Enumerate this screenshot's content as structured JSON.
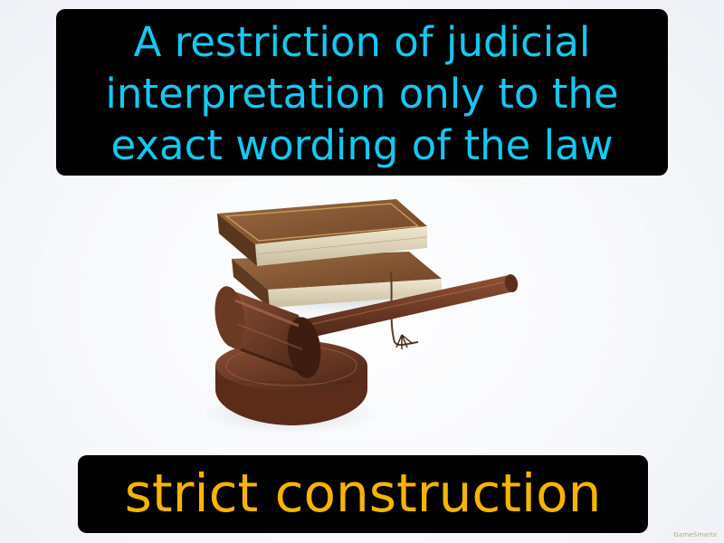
{
  "definition": {
    "lines": [
      "A restriction of judicial",
      "interpretation only to the",
      "exact wording of the law"
    ]
  },
  "term": "strict construction",
  "watermark": "GameSmartz",
  "colors": {
    "definition_text": "#14c8f0",
    "term_text": "#f6b400",
    "box_background": "#000000"
  }
}
